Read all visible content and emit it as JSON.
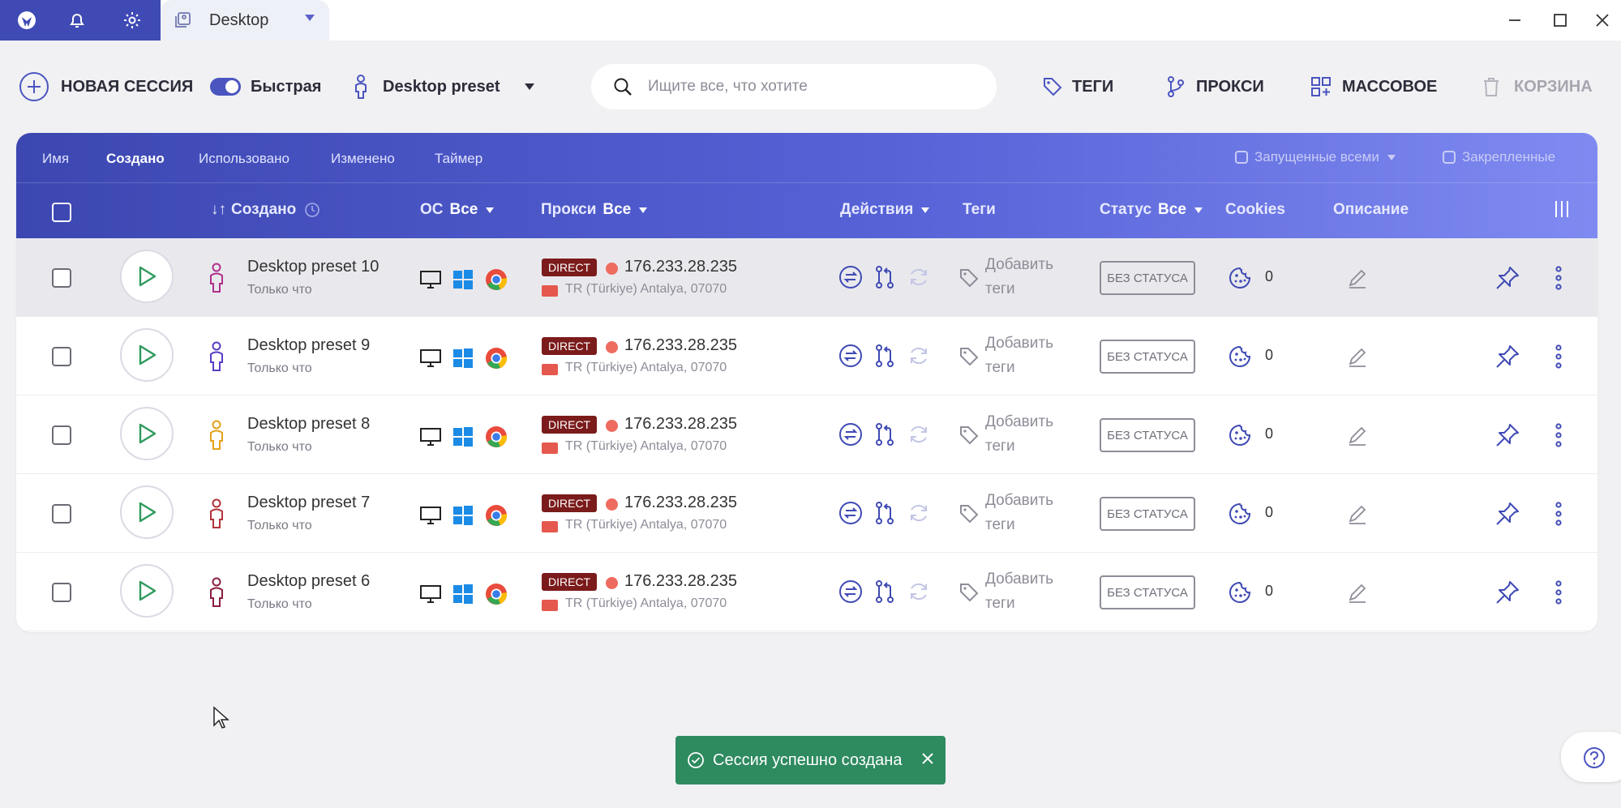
{
  "titlebar": {
    "tab_label": "Desktop",
    "icons": [
      "logo-icon",
      "bell-icon",
      "gear-icon",
      "profile-tab-icon"
    ],
    "window_controls": [
      "minimize-icon",
      "maximize-icon",
      "close-icon"
    ]
  },
  "toolbar": {
    "new_session": "НОВАЯ СЕССИЯ",
    "fast_toggle": "Быстрая",
    "fast_toggle_on": true,
    "preset": "Desktop preset",
    "search_placeholder": "Ищите все, что хотите",
    "tags": "ТЕГИ",
    "proxy": "ПРОКСИ",
    "bulk": "МАССОВОЕ",
    "trash": "КОРЗИНА"
  },
  "sortbar": {
    "items": [
      "Имя",
      "Создано",
      "Использовано",
      "Изменено",
      "Таймер"
    ],
    "active": "Создано",
    "running_all": "Запущенные всеми",
    "pinned": "Закрепленные"
  },
  "columns": {
    "created": "Создано",
    "os": "ОС",
    "os_filter": "Все",
    "proxy": "Прокси",
    "proxy_filter": "Все",
    "actions": "Действия",
    "tags": "Теги",
    "status": "Статус",
    "status_filter": "Все",
    "cookies": "Cookies",
    "description": "Описание"
  },
  "rows": [
    {
      "name": "Desktop preset 10",
      "time": "Только что",
      "proxy_type": "DIRECT",
      "ip": "176.233.28.235",
      "geo": "TR (Türkiye) Antalya, 07070",
      "add_tags": "Добавить теги",
      "status": "БЕЗ СТАТУСА",
      "cookies": "0",
      "person_color": "#b0308a"
    },
    {
      "name": "Desktop preset 9",
      "time": "Только что",
      "proxy_type": "DIRECT",
      "ip": "176.233.28.235",
      "geo": "TR (Türkiye) Antalya, 07070",
      "add_tags": "Добавить теги",
      "status": "БЕЗ СТАТУСА",
      "cookies": "0",
      "person_color": "#5a3cc8"
    },
    {
      "name": "Desktop preset 8",
      "time": "Только что",
      "proxy_type": "DIRECT",
      "ip": "176.233.28.235",
      "geo": "TR (Türkiye) Antalya, 07070",
      "add_tags": "Добавить теги",
      "status": "БЕЗ СТАТУСА",
      "cookies": "0",
      "person_color": "#e3a21a"
    },
    {
      "name": "Desktop preset 7",
      "time": "Только что",
      "proxy_type": "DIRECT",
      "ip": "176.233.28.235",
      "geo": "TR (Türkiye) Antalya, 07070",
      "add_tags": "Добавить теги",
      "status": "БЕЗ СТАТУСА",
      "cookies": "0",
      "person_color": "#b3323a"
    },
    {
      "name": "Desktop preset 6",
      "time": "Только что",
      "proxy_type": "DIRECT",
      "ip": "176.233.28.235",
      "geo": "TR (Türkiye) Antalya, 07070",
      "add_tags": "Добавить теги",
      "status": "БЕЗ СТАТУСА",
      "cookies": "0",
      "person_color": "#8b1f3f"
    }
  ],
  "toast": {
    "message": "Сессия успешно создана"
  },
  "colors": {
    "accent": "#3f4ab4",
    "toast": "#2e8a5f",
    "direct_badge": "#7b1b1b"
  }
}
